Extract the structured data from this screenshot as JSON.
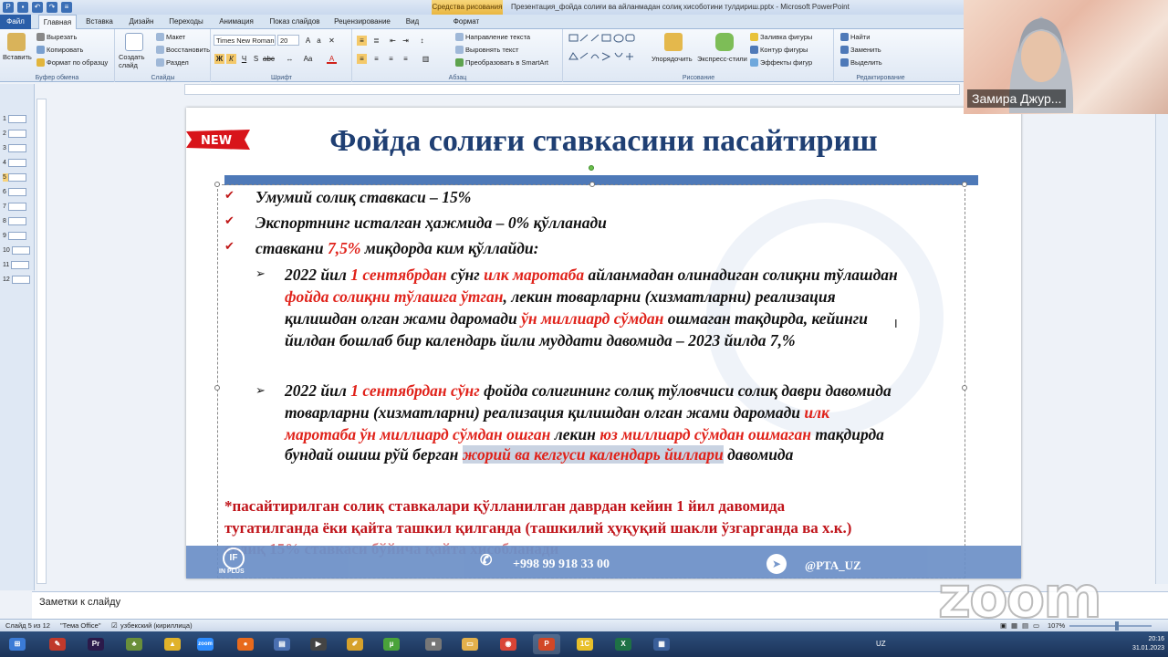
{
  "window": {
    "title": "Презентация_фойда солиғи ва айланмадан солиқ хисоботини тулдириш.pptx  -  Microsoft PowerPoint",
    "context_tab": "Средства рисования",
    "context_sub": "Формат"
  },
  "tabs": [
    "Файл",
    "Главная",
    "Вставка",
    "Дизайн",
    "Переходы",
    "Анимация",
    "Показ слайдов",
    "Рецензирование",
    "Вид"
  ],
  "ribbon": {
    "clipboard": {
      "paste": "Вставить",
      "cut": "Вырезать",
      "copy": "Копировать",
      "format_painter": "Формат по образцу",
      "label": "Буфер обмена"
    },
    "slides": {
      "new_slide": "Создать слайд",
      "layout": "Макет",
      "reset": "Восстановить",
      "section": "Раздел",
      "label": "Слайды"
    },
    "font": {
      "name": "Times New Roman",
      "size": "20",
      "label": "Шрифт"
    },
    "paragraph": {
      "text_direction": "Направление текста",
      "align_text": "Выровнять текст",
      "smartart": "Преобразовать в SmartArt",
      "label": "Абзац"
    },
    "drawing": {
      "arrange": "Упорядочить",
      "quick_styles": "Экспресс-стили",
      "fill": "Заливка фигуры",
      "outline": "Контур фигуры",
      "effects": "Эффекты фигур",
      "label": "Рисование"
    },
    "editing": {
      "find": "Найти",
      "replace": "Заменить",
      "select": "Выделить",
      "label": "Редактирование"
    }
  },
  "slide_panel": [
    "1",
    "2",
    "3",
    "4",
    "5",
    "6",
    "7",
    "8",
    "9",
    "10",
    "11",
    "12"
  ],
  "slide": {
    "badge": "NEW",
    "title": "Фойда солиғи ставкасини пасайтириш",
    "bullets": [
      "Умумий солиқ ставкаси – 15%",
      "Экспортнинг исталган ҳажмида – 0% қўлланади"
    ],
    "b3_a": "ставкани ",
    "b3_red": "7,5%",
    "b3_b": " миқдорда ким қўллайди:",
    "s1": {
      "l1a": "2022 йил ",
      "l1r1": "1 сентябрдан",
      "l1b": " сўнг ",
      "l1r2": "илк маротаба",
      "l1c": " айланмадан олинадиган солиқни тўлашдан",
      "l2r": "фойда солиқни тўлашга ўтган",
      "l2b": ", лекин товарларни (хизматларни) реализация",
      "l3a": "қилишдан олган жами даромади ",
      "l3r": "ўн миллиард сўмдан",
      "l3b": " ошмаган тақдирда, кейинги",
      "l4": "йилдан бошлаб бир календарь йили муддати давомида – 2023 йилда 7,%"
    },
    "s2": {
      "l1a": "2022 йил ",
      "l1r": "1 сентябрдан сўнг",
      "l1b": " фойда солиғининг солиқ тўловчиси солиқ даври давомида",
      "l2": "товарларни (хизматларни) реализация қилишдан олган жами даромади ",
      "l2r": "илк",
      "l3r1": "маротаба ўн миллиард сўмдан ошган",
      "l3b": " лекин ",
      "l3r2": "юз миллиард сўмдан ошмаган",
      "l3c": " тақдирда",
      "l4a": "бундай ошиш рўй берган ",
      "l4h": "жорий ва келгуси календарь йиллари",
      "l4b": " давомида"
    },
    "note": [
      "*пасайтирилган солиқ ставкалари қўлланилган даврдан кейин 1 йил давомида",
      "тугатилганда ёки қайта ташкил қилганда (ташкилий ҳуқуқий шакли ўзгарганда ва х.к.)",
      "солиқ 15% ставкаси бўйича қайта хисобланади"
    ],
    "footer": {
      "logo": "IF",
      "logo_sub": "IN PLUS",
      "phone": "+998 99 918 33 00",
      "telegram": "@PTA_UZ"
    }
  },
  "notes_placeholder": "Заметки к слайду",
  "status": {
    "slide": "Слайд 5 из 12",
    "theme": "\"Тема Office\"",
    "lang": "узбекский (кириллица)",
    "zoom": "107%"
  },
  "webcam": {
    "name": "Замира Джур..."
  },
  "zoom_logo": "zoom",
  "clock": {
    "time": "20:16",
    "date": "31.01.2023",
    "lang": "UZ"
  },
  "taskbar": [
    {
      "name": "start",
      "color": "#3b7bd6",
      "label": "⊞"
    },
    {
      "name": "app-red",
      "color": "#c0392b",
      "label": "✎"
    },
    {
      "name": "premiere",
      "color": "#2b1a4a",
      "label": "Pr"
    },
    {
      "name": "app-green",
      "color": "#6a8f3a",
      "label": "♣"
    },
    {
      "name": "app-yellow",
      "color": "#e0b22a",
      "label": "▲"
    },
    {
      "name": "zoom",
      "color": "#2d8cff",
      "label": "zoom"
    },
    {
      "name": "firefox",
      "color": "#e86a1c",
      "label": "●"
    },
    {
      "name": "app-doc",
      "color": "#4a6fb0",
      "label": "▤"
    },
    {
      "name": "app-clapper",
      "color": "#444",
      "label": "▶"
    },
    {
      "name": "app-notes",
      "color": "#d6a12b",
      "label": "✐"
    },
    {
      "name": "utorrent",
      "color": "#4aa33a",
      "label": "µ"
    },
    {
      "name": "app-gray",
      "color": "#777",
      "label": "■"
    },
    {
      "name": "explorer",
      "color": "#e3b04b",
      "label": "▭"
    },
    {
      "name": "chrome",
      "color": "#d94436",
      "label": "◉"
    },
    {
      "name": "powerpoint",
      "color": "#d24726",
      "label": "P"
    },
    {
      "name": "1c",
      "color": "#e8c02a",
      "label": "1C"
    },
    {
      "name": "excel",
      "color": "#1e7145",
      "label": "X"
    },
    {
      "name": "app-win",
      "color": "#3a5f9a",
      "label": "▦"
    }
  ]
}
